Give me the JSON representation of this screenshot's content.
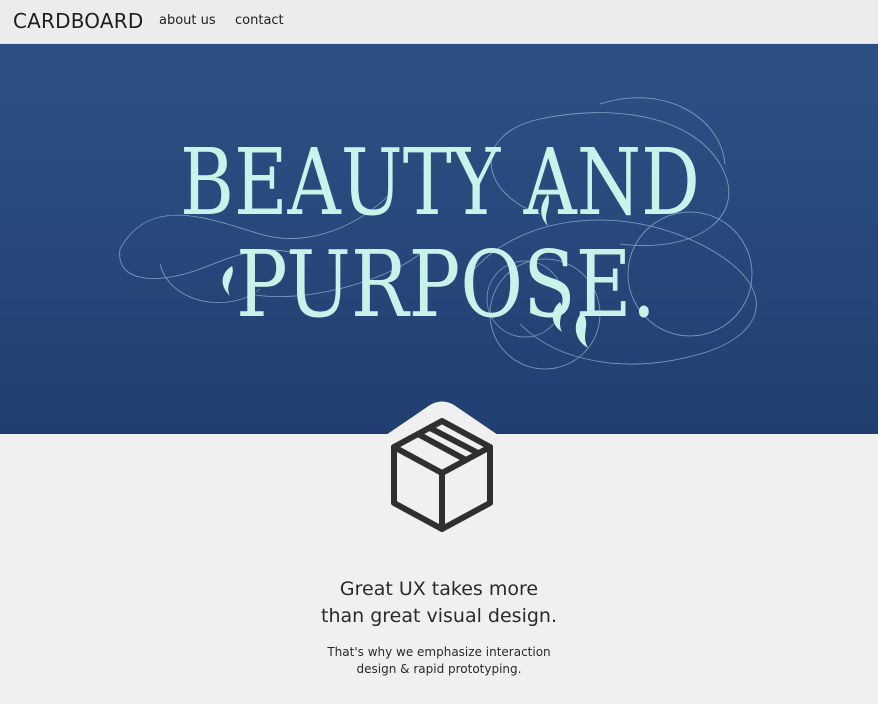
{
  "nav": {
    "brand": "CARDBOARD",
    "links": [
      {
        "label": "about us"
      },
      {
        "label": "contact"
      }
    ]
  },
  "hero": {
    "line1": "BEAUTY AND",
    "line2": "PURPOSE."
  },
  "content": {
    "headline_line1": "Great UX takes more",
    "headline_line2": "than great visual design.",
    "sub_line1": "That's why we emphasize interaction",
    "sub_line2": "design & rapid prototyping."
  },
  "icons": {
    "box": "cardboard-box-icon"
  },
  "colors": {
    "hero_top": "#2d5084",
    "hero_bottom": "#203f70",
    "hero_text": "#c8f3ea",
    "page_bg": "#f1f0f1",
    "nav_bg": "#ececee"
  }
}
